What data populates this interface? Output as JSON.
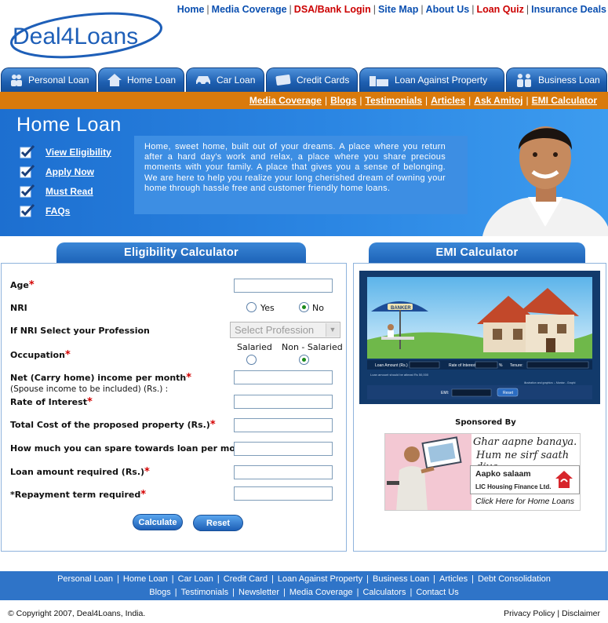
{
  "top_nav": [
    {
      "label": "Home",
      "red": false
    },
    {
      "label": "Media Coverage",
      "red": false
    },
    {
      "label": "DSA/Bank Login",
      "red": true
    },
    {
      "label": "Site Map",
      "red": false
    },
    {
      "label": "About Us",
      "red": false
    },
    {
      "label": "Loan Quiz",
      "red": true
    },
    {
      "label": "Insurance Deals",
      "red": false
    }
  ],
  "logo": {
    "text": "Deal4Loans"
  },
  "tabs": [
    {
      "label": "Personal Loan",
      "icon": "people-icon"
    },
    {
      "label": "Home Loan",
      "icon": "house-icon"
    },
    {
      "label": "Car Loan",
      "icon": "car-icon"
    },
    {
      "label": "Credit Cards",
      "icon": "credit-card-icon"
    },
    {
      "label": "Loan Against Property",
      "icon": "building-icon"
    },
    {
      "label": "Business Loan",
      "icon": "business-people-icon"
    }
  ],
  "sub_nav": [
    "Media Coverage",
    "Blogs",
    "Testimonials",
    "Articles",
    "Ask Amitoj",
    "EMI Calculator"
  ],
  "hero": {
    "title": "Home Loan",
    "links": [
      "View Eligibility",
      "Apply Now",
      "Must Read",
      "FAQs"
    ],
    "text": "Home, sweet home, built out of your dreams. A place where you return after a hard day's work and relax, a place where you share precious moments with your family. A place that gives you a sense of belonging. We are here to help you realize your long cherished dream of owning your home through hassle free and customer friendly home loans."
  },
  "eligibility": {
    "title": "Eligibility Calculator",
    "age_label": "Age",
    "nri_label": "NRI",
    "nri_yes": "Yes",
    "nri_no": "No",
    "nri_selected": "No",
    "profession_label": "If NRI Select your Profession",
    "profession_placeholder": "Select Profession",
    "occupation_label": "Occupation",
    "occ_salaried": "Salaried",
    "occ_non_salaried": "Non - Salaried",
    "occ_selected": "Non - Salaried",
    "income_label": "Net (Carry home) income per month",
    "income_sub": "(Spouse income to be included) (Rs.) :",
    "rate_label": "Rate of Interest",
    "cost_label": "Total Cost of the proposed property (Rs.)",
    "spare_label": "How much you can spare towards loan per month",
    "loan_amount_label": "Loan amount required (Rs.)",
    "term_label": "*Repayment term required",
    "calculate": "Calculate",
    "reset": "Reset"
  },
  "emi": {
    "title": "EMI Calculator",
    "banker_sign": "BANKER",
    "loan_amount": "Loan Amount (Rs.)",
    "rate": "Rate of Interest:",
    "tenure": "Tenure:",
    "percent": "%",
    "emi_label": "EMI:",
    "reset": "Reset",
    "allowed_note": "Loan amount should be atleast Rs 50,000",
    "credit": "illustration and graphics :- Mantar - Graphi"
  },
  "sponsor": {
    "title": "Sponsored By",
    "line1": "Ghar aapne banaya.",
    "line2": "Hum ne sirf saath diya.",
    "salaam": "Aapko salaam",
    "company": "LIC Housing Finance Ltd.",
    "cta": "Click Here for Home Loans"
  },
  "footer": {
    "row1": [
      "Personal Loan",
      "Home Loan",
      "Car Loan",
      "Credit Card",
      "Loan Against Property",
      "Business Loan",
      "Articles",
      "Debt Consolidation"
    ],
    "row2": [
      "Blogs",
      "Testimonials",
      "Newsletter",
      "Media Coverage",
      "Calculators",
      "Contact Us"
    ],
    "copyright": "© Copyright 2007, Deal4Loans, India.",
    "privacy": "Privacy Policy",
    "disclaimer": "Disclaimer"
  },
  "colors": {
    "brand_blue": "#1d63b8",
    "orange": "#d97a0c",
    "link_blue": "#0a4fb0",
    "required_red": "#d40000"
  }
}
